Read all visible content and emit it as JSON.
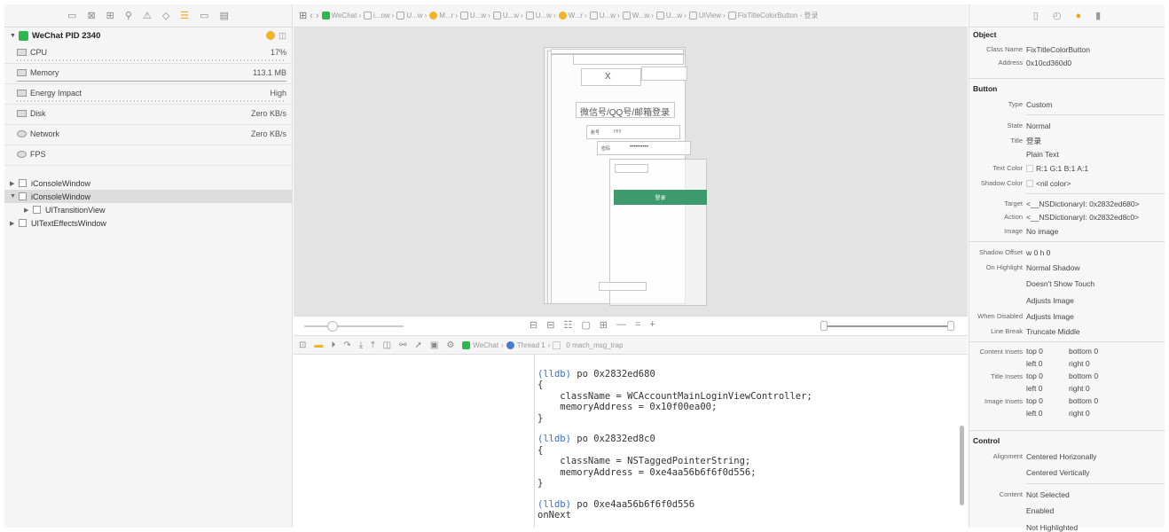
{
  "navigator": {
    "process": {
      "name": "WeChat PID 2340"
    },
    "metrics": [
      {
        "label": "CPU",
        "value": "17%"
      },
      {
        "label": "Memory",
        "value": "113.1 MB"
      },
      {
        "label": "Energy Impact",
        "value": "High"
      },
      {
        "label": "Disk",
        "value": "Zero KB/s"
      },
      {
        "label": "Network",
        "value": "Zero KB/s"
      },
      {
        "label": "FPS",
        "value": ""
      }
    ],
    "tree": [
      {
        "label": "iConsoleWindow"
      },
      {
        "label": "iConsoleWindow"
      },
      {
        "label": "UITransitionView"
      },
      {
        "label": "UITextEffectsWindow"
      }
    ]
  },
  "jumpbar": {
    "crumbs": [
      "WeChat",
      "i...ow",
      "U...w",
      "M...r",
      "U...w",
      "U...w",
      "U...w",
      "W...r",
      "U...w",
      "W...w",
      "U...w",
      "UIView",
      "FixTitleColorButton - 登录"
    ]
  },
  "canvas": {
    "phone_title": "微信号/QQ号/邮箱登录",
    "close_glyph": "X",
    "account_label": "账号",
    "account_value": "!!!!!!",
    "password_label": "密码",
    "password_value": "••••••••••",
    "login_label": "登录"
  },
  "debug_bar": {
    "crumbs": [
      "WeChat",
      "Thread 1",
      "0 mach_msg_trap"
    ]
  },
  "console": {
    "blocks": [
      {
        "prompt": "(lldb)",
        "cmd": "po 0x2832ed680",
        "body": "{\n    className = WCAccountMainLoginViewController;\n    memoryAddress = 0x10f00ea00;\n}"
      },
      {
        "prompt": "(lldb)",
        "cmd": "po 0x2832ed8c0",
        "body": "{\n    className = NSTaggedPointerString;\n    memoryAddress = 0xe4aa56b6f6f0d556;\n}"
      },
      {
        "prompt": "(lldb)",
        "cmd": "po 0xe4aa56b6f6f0d556",
        "body": "onNext"
      }
    ]
  },
  "inspector": {
    "object": {
      "title": "Object",
      "class_name_label": "Class Name",
      "class_name": "FixTitleColorButton",
      "address_label": "Address",
      "address": "0x10cd360d0"
    },
    "button": {
      "title": "Button",
      "type_label": "Type",
      "type": "Custom",
      "state_label": "State",
      "state": "Normal",
      "title_label": "Title",
      "title_val": "登录",
      "title_kind": "Plain Text",
      "text_color_label": "Text Color",
      "text_color": "R:1 G:1 B:1 A:1",
      "shadow_color_label": "Shadow Color",
      "shadow_color": "<nil color>",
      "target_label": "Target",
      "target": "<__NSDictionaryI: 0x2832ed680>",
      "action_label": "Action",
      "action": "<__NSDictionaryI: 0x2832ed8c0>",
      "image_label": "Image",
      "image": "No image",
      "shadow_offset_label": "Shadow Offset",
      "shadow_offset": "w 0   h 0",
      "on_highlight_label": "On Highlight",
      "on_highlight": "Normal Shadow",
      "touch": "Doesn't Show Touch",
      "adjusts": "Adjusts Image",
      "when_disabled_label": "When Disabled",
      "when_disabled": "Adjusts Image",
      "line_break_label": "Line Break",
      "line_break": "Truncate Middle"
    },
    "insets": [
      {
        "label": "Content Insets",
        "top": "top 0",
        "bottom": "bottom 0",
        "left": "left 0",
        "right": "right 0"
      },
      {
        "label": "Title Insets",
        "top": "top 0",
        "bottom": "bottom 0",
        "left": "left 0",
        "right": "right 0"
      },
      {
        "label": "Image Insets",
        "top": "top 0",
        "bottom": "bottom 0",
        "left": "left 0",
        "right": "right 0"
      }
    ],
    "control": {
      "title": "Control",
      "alignment_label": "Alignment",
      "alignment_h": "Centered Horizonally",
      "alignment_v": "Centered Vertically",
      "content_label": "Content",
      "content_selected": "Not Selected",
      "content_enabled": "Enabled",
      "content_highlighted": "Not Highlighted"
    }
  },
  "colors": {
    "accent": "#f0a31f",
    "wechat_green": "#2db84d",
    "login_button": "#3d9a6d"
  }
}
